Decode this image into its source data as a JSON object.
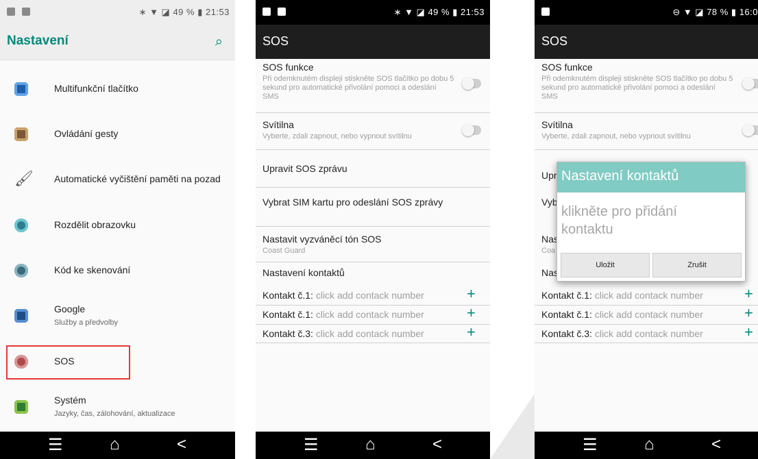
{
  "settings_screen": {
    "status": {
      "right": "∗ ▼ ◪ 49 % ▮ 21:53"
    },
    "title": "Nastavení",
    "items": [
      {
        "label": "Multifunkční tlačítko"
      },
      {
        "label": "Ovládání gesty"
      },
      {
        "label": "Automatické vyčištění paměti na pozad"
      },
      {
        "label": "Rozdělit obrazovku"
      },
      {
        "label": "Kód ke skenování"
      },
      {
        "label": "Google",
        "sub": "Služby a předvolby"
      },
      {
        "label": "SOS"
      },
      {
        "label": "Systém",
        "sub": "Jazyky, čas, zálohování, aktualizace"
      }
    ]
  },
  "sos_screen": {
    "status": {
      "right": "∗ ▼ ◪ 49 % ▮ 21:53"
    },
    "title": "SOS",
    "sos_function": {
      "title": "SOS funkce",
      "desc": "Při odemknutém displeji stiskněte SOS tlačítko po dobu 5 sekund pro automatické přivolání pomoci a odeslání SMS",
      "enabled": false
    },
    "flashlight": {
      "title": "Svítilna",
      "desc": "Vyberte, zdali zapnout, nebo vypnout svítilnu",
      "enabled": false
    },
    "edit_message": "Upravit SOS zprávu",
    "select_sim": "Vybrat SIM kartu pro odeslání SOS zprávy",
    "ringtone": {
      "title": "Nastavit vyzváněcí tón SOS",
      "value": "Coast Guard"
    },
    "contacts_title": "Nastavení kontaktů",
    "contacts": [
      {
        "label": "Kontakt č.1:",
        "value": "click add contack number"
      },
      {
        "label": "Kontakt č.1:",
        "value": "click add contack number"
      },
      {
        "label": "Kontakt č.3:",
        "value": "click add contack number"
      }
    ]
  },
  "dialog_screen": {
    "status": {
      "right": "⊖ ▼ ◪ 78 % ▮ 16:0"
    },
    "title": "SOS",
    "sos_function": {
      "title": "SOS funkce",
      "desc": "Při odemknutém displeji stiskněte SOS tlačítko po dobu 5 sekund pro automatické přivolání pomoci a odeslání SMS"
    },
    "flashlight": {
      "title": "Svítilna",
      "desc": "Vyberte, zdali zapnout, nebo vypnout svítilnu"
    },
    "partial": {
      "edit": "Upr",
      "sim": "Vyb",
      "ring": "Nas",
      "coast": "Coa",
      "contacts": "Nas"
    },
    "dialog": {
      "title": "Nastavení kontaktů",
      "message": "klikněte pro přidání kontaktu",
      "save": "Uložit",
      "cancel": "Zrušit"
    },
    "contacts": [
      {
        "label": "Kontakt č.1:",
        "value": "click add contack number"
      },
      {
        "label": "Kontakt č.1:",
        "value": "click add contack number"
      },
      {
        "label": "Kontakt č.3:",
        "value": "click add contack number"
      }
    ]
  },
  "navbar": {
    "menu": "☰",
    "home": "⌂",
    "back": "<"
  },
  "icons": {
    "search": "search-icon",
    "accent_color": "#00897b",
    "highlight_color": "#e53935"
  }
}
